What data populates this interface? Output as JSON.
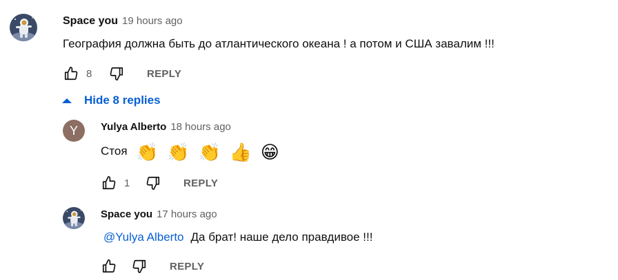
{
  "comment": {
    "author": "Space you",
    "time": "19 hours ago",
    "text": "География должна быть до атлантического океана ! а потом и США завалим !!!",
    "likes": "8",
    "reply_label": "REPLY"
  },
  "hide_replies_label": "Hide 8 replies",
  "replies": [
    {
      "avatar_letter": "Y",
      "author": "Yulya Alberto",
      "time": "18 hours ago",
      "text": "Стоя",
      "emojis": [
        "👏",
        "👏",
        "👏",
        "👍",
        "😁"
      ],
      "likes": "1",
      "reply_label": "REPLY"
    },
    {
      "author": "Space you",
      "time": "17 hours ago",
      "mention": "@Yulya Alberto",
      "text": "Да брат! наше дело правдивое !!!",
      "likes": "",
      "reply_label": "REPLY"
    }
  ],
  "icons": {
    "like": "thumb-up-icon",
    "dislike": "thumb-down-icon",
    "collapse": "caret-up-icon"
  },
  "colors": {
    "link": "#065fd4",
    "secondary_text": "#606060",
    "letter_avatar_bg": "#8d6e63"
  }
}
